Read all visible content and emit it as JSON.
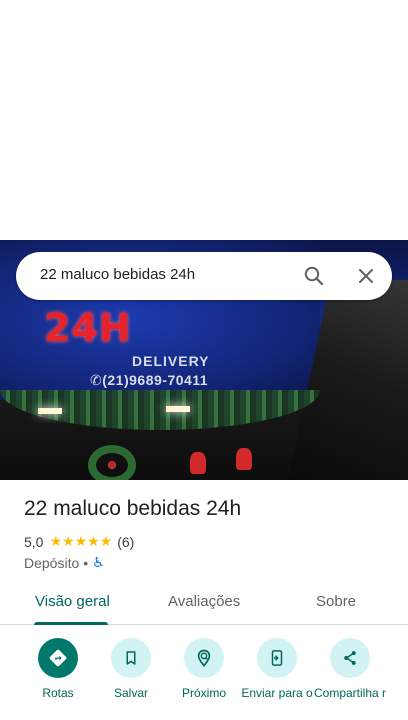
{
  "search": {
    "query": "22 maluco bebidas 24h"
  },
  "photo": {
    "sign_main": "24H",
    "sign_delivery": "DELIVERY",
    "sign_phone": "(21)9689-70411"
  },
  "place": {
    "name": "22 maluco bebidas 24h",
    "rating": "5,0",
    "stars": "★★★★★",
    "review_count": "(6)",
    "category": "Depósito",
    "separator": "•",
    "accessibility_icon": "♿"
  },
  "tabs": [
    {
      "label": "Visão geral",
      "active": true
    },
    {
      "label": "Avaliações",
      "active": false
    },
    {
      "label": "Sobre",
      "active": false
    }
  ],
  "actions": [
    {
      "label": "Rotas",
      "icon": "directions-icon"
    },
    {
      "label": "Salvar",
      "icon": "bookmark-icon"
    },
    {
      "label": "Próximo",
      "icon": "nearby-icon"
    },
    {
      "label": "Enviar para o",
      "icon": "send-to-phone-icon"
    },
    {
      "label": "Compartilha r",
      "icon": "share-icon"
    }
  ],
  "colors": {
    "accent": "#00695c",
    "primary_button": "#00796b",
    "action_bg": "#d2f3f4",
    "star": "#fbbc04"
  }
}
